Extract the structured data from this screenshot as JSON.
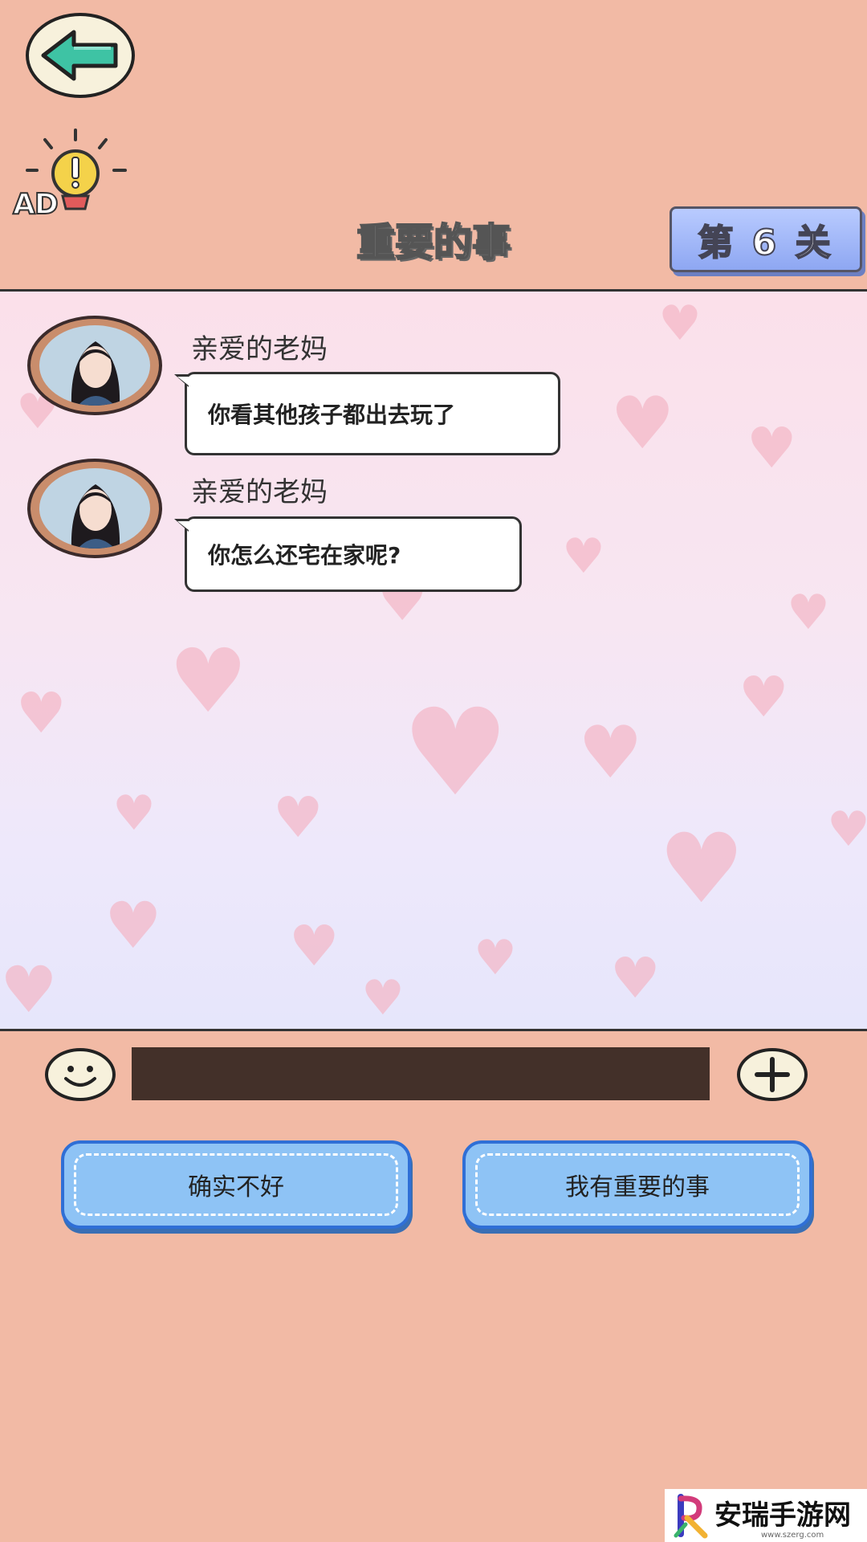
{
  "header": {
    "back_icon": "arrow-left-icon",
    "hint_icon": "lightbulb-icon",
    "ad_label": "AD",
    "title": "重要的事",
    "level": "第 6 关"
  },
  "chat": {
    "messages": [
      {
        "sender": "亲爱的老妈",
        "text": "你看其他孩子都出去玩了"
      },
      {
        "sender": "亲爱的老妈",
        "text": "你怎么还宅在家呢?"
      }
    ]
  },
  "input_bar": {
    "emoji_icon": "smiley-icon",
    "input_value": "",
    "plus_icon": "plus-icon"
  },
  "choices": [
    {
      "label": "确实不好"
    },
    {
      "label": "我有重要的事"
    }
  ],
  "watermark": {
    "text": "安瑞手游网",
    "url": "www.szerg.com"
  },
  "colors": {
    "background": "#f2baa5",
    "choice_fill": "#8ec3f5",
    "choice_border": "#2f6fd6",
    "level_badge": "#9fb5f6",
    "input_fill": "#433029"
  }
}
